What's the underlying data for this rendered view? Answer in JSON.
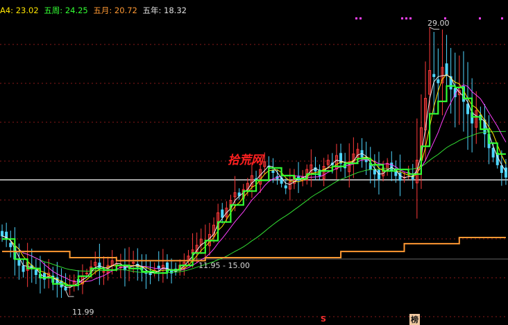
{
  "legend": [
    {
      "text": "A4: 23.02",
      "color": "#ffe600"
    },
    {
      "text": "五周: 24.25",
      "color": "#33ff33"
    },
    {
      "text": "五月: 20.72",
      "color": "#ff9933"
    },
    {
      "text": "五年: 18.32",
      "color": "#e0e0e0"
    }
  ],
  "watermark": "拾荒网",
  "annotations": {
    "high": "29.00",
    "low": "11.99",
    "range": "11.95 - 15.00"
  },
  "markers": {
    "s_label": "S",
    "bang_label": "榜"
  },
  "colors": {
    "up": "#ff3b3b",
    "down": "#4fd6ff",
    "ma_white": "#f0f0f0",
    "ma_yellow": "#ffe600",
    "ma_magenta": "#ff40ff",
    "ma_green": "#33dd33",
    "weekly_step": "#33ff33",
    "monthly_step": "#ff9933",
    "yearly_line": "#c8c8c8",
    "grid": "#8b1a1a"
  },
  "chart_data": {
    "type": "candlestick",
    "ylim": [
      11,
      29.5
    ],
    "bars": 120,
    "annotated_values": {
      "high": 29.0,
      "low": 11.99,
      "range_low": 11.95,
      "range_high": 15.0
    },
    "close_series": [
      15.5,
      15.3,
      14.8,
      14.0,
      13.6,
      13.2,
      13.8,
      13.4,
      13.0,
      12.8,
      12.7,
      13.1,
      12.5,
      12.4,
      12.2,
      12.0,
      12.3,
      12.6,
      12.5,
      12.9,
      13.1,
      13.5,
      13.8,
      13.4,
      13.2,
      13.6,
      13.9,
      13.7,
      13.5,
      13.3,
      13.6,
      13.8,
      13.5,
      13.3,
      13.1,
      13.0,
      13.3,
      13.4,
      13.6,
      13.2,
      13.1,
      13.3,
      13.6,
      13.8,
      14.2,
      14.6,
      14.9,
      15.3,
      15.1,
      15.6,
      16.2,
      17.0,
      16.7,
      17.3,
      17.8,
      18.3,
      18.1,
      18.5,
      18.9,
      19.4,
      19.1,
      19.8,
      20.3,
      20.0,
      19.6,
      19.2,
      18.9,
      18.6,
      19.0,
      19.4,
      19.1,
      19.3,
      19.8,
      20.1,
      19.7,
      19.4,
      20.0,
      20.4,
      20.1,
      20.7,
      20.2,
      19.9,
      20.3,
      20.8,
      21.1,
      20.6,
      20.3,
      19.8,
      19.5,
      19.2,
      19.9,
      20.2,
      19.7,
      19.4,
      19.1,
      19.3,
      19.6,
      19.2,
      20.4,
      22.5,
      24.4,
      26.2,
      25.8,
      25.4,
      26.4,
      25.9,
      25.0,
      24.5,
      24.9,
      24.2,
      23.4,
      22.8,
      23.6,
      23.0,
      22.1,
      21.2,
      20.6,
      20.1,
      19.6,
      19.3
    ],
    "weekly_step": [
      [
        0,
        15.3
      ],
      [
        3,
        14.0
      ],
      [
        6,
        13.4
      ],
      [
        9,
        12.8
      ],
      [
        12,
        12.4
      ],
      [
        15,
        12.3
      ],
      [
        18,
        12.9
      ],
      [
        21,
        13.4
      ],
      [
        24,
        13.3
      ],
      [
        27,
        13.6
      ],
      [
        30,
        13.4
      ],
      [
        33,
        13.2
      ],
      [
        36,
        13.1
      ],
      [
        39,
        13.3
      ],
      [
        42,
        13.6
      ],
      [
        45,
        14.4
      ],
      [
        48,
        15.2
      ],
      [
        51,
        16.4
      ],
      [
        54,
        17.5
      ],
      [
        57,
        18.4
      ],
      [
        60,
        19.1
      ],
      [
        63,
        19.9
      ],
      [
        66,
        19.4
      ],
      [
        69,
        19.2
      ],
      [
        72,
        19.5
      ],
      [
        75,
        19.7
      ],
      [
        78,
        20.0
      ],
      [
        81,
        20.2
      ],
      [
        84,
        20.5
      ],
      [
        87,
        20.1
      ],
      [
        90,
        19.7
      ],
      [
        93,
        19.8
      ],
      [
        96,
        19.5
      ],
      [
        99,
        21.3
      ],
      [
        101,
        23.4
      ],
      [
        103,
        24.2
      ],
      [
        105,
        25.2
      ],
      [
        107,
        25.1
      ],
      [
        109,
        24.4
      ],
      [
        111,
        23.2
      ],
      [
        113,
        22.4
      ],
      [
        115,
        21.5
      ],
      [
        117,
        20.8
      ],
      [
        119,
        20.8
      ]
    ],
    "monthly_step": [
      [
        0,
        14.5
      ],
      [
        16,
        14.5
      ],
      [
        16,
        14.1
      ],
      [
        27,
        14.1
      ],
      [
        27,
        13.9
      ],
      [
        48,
        13.9
      ],
      [
        48,
        14.1
      ],
      [
        80,
        14.1
      ],
      [
        80,
        14.5
      ],
      [
        95,
        14.5
      ],
      [
        95,
        15.0
      ],
      [
        108,
        15.0
      ],
      [
        108,
        15.4
      ],
      [
        119,
        15.4
      ]
    ],
    "yearly_level": 19.0
  }
}
